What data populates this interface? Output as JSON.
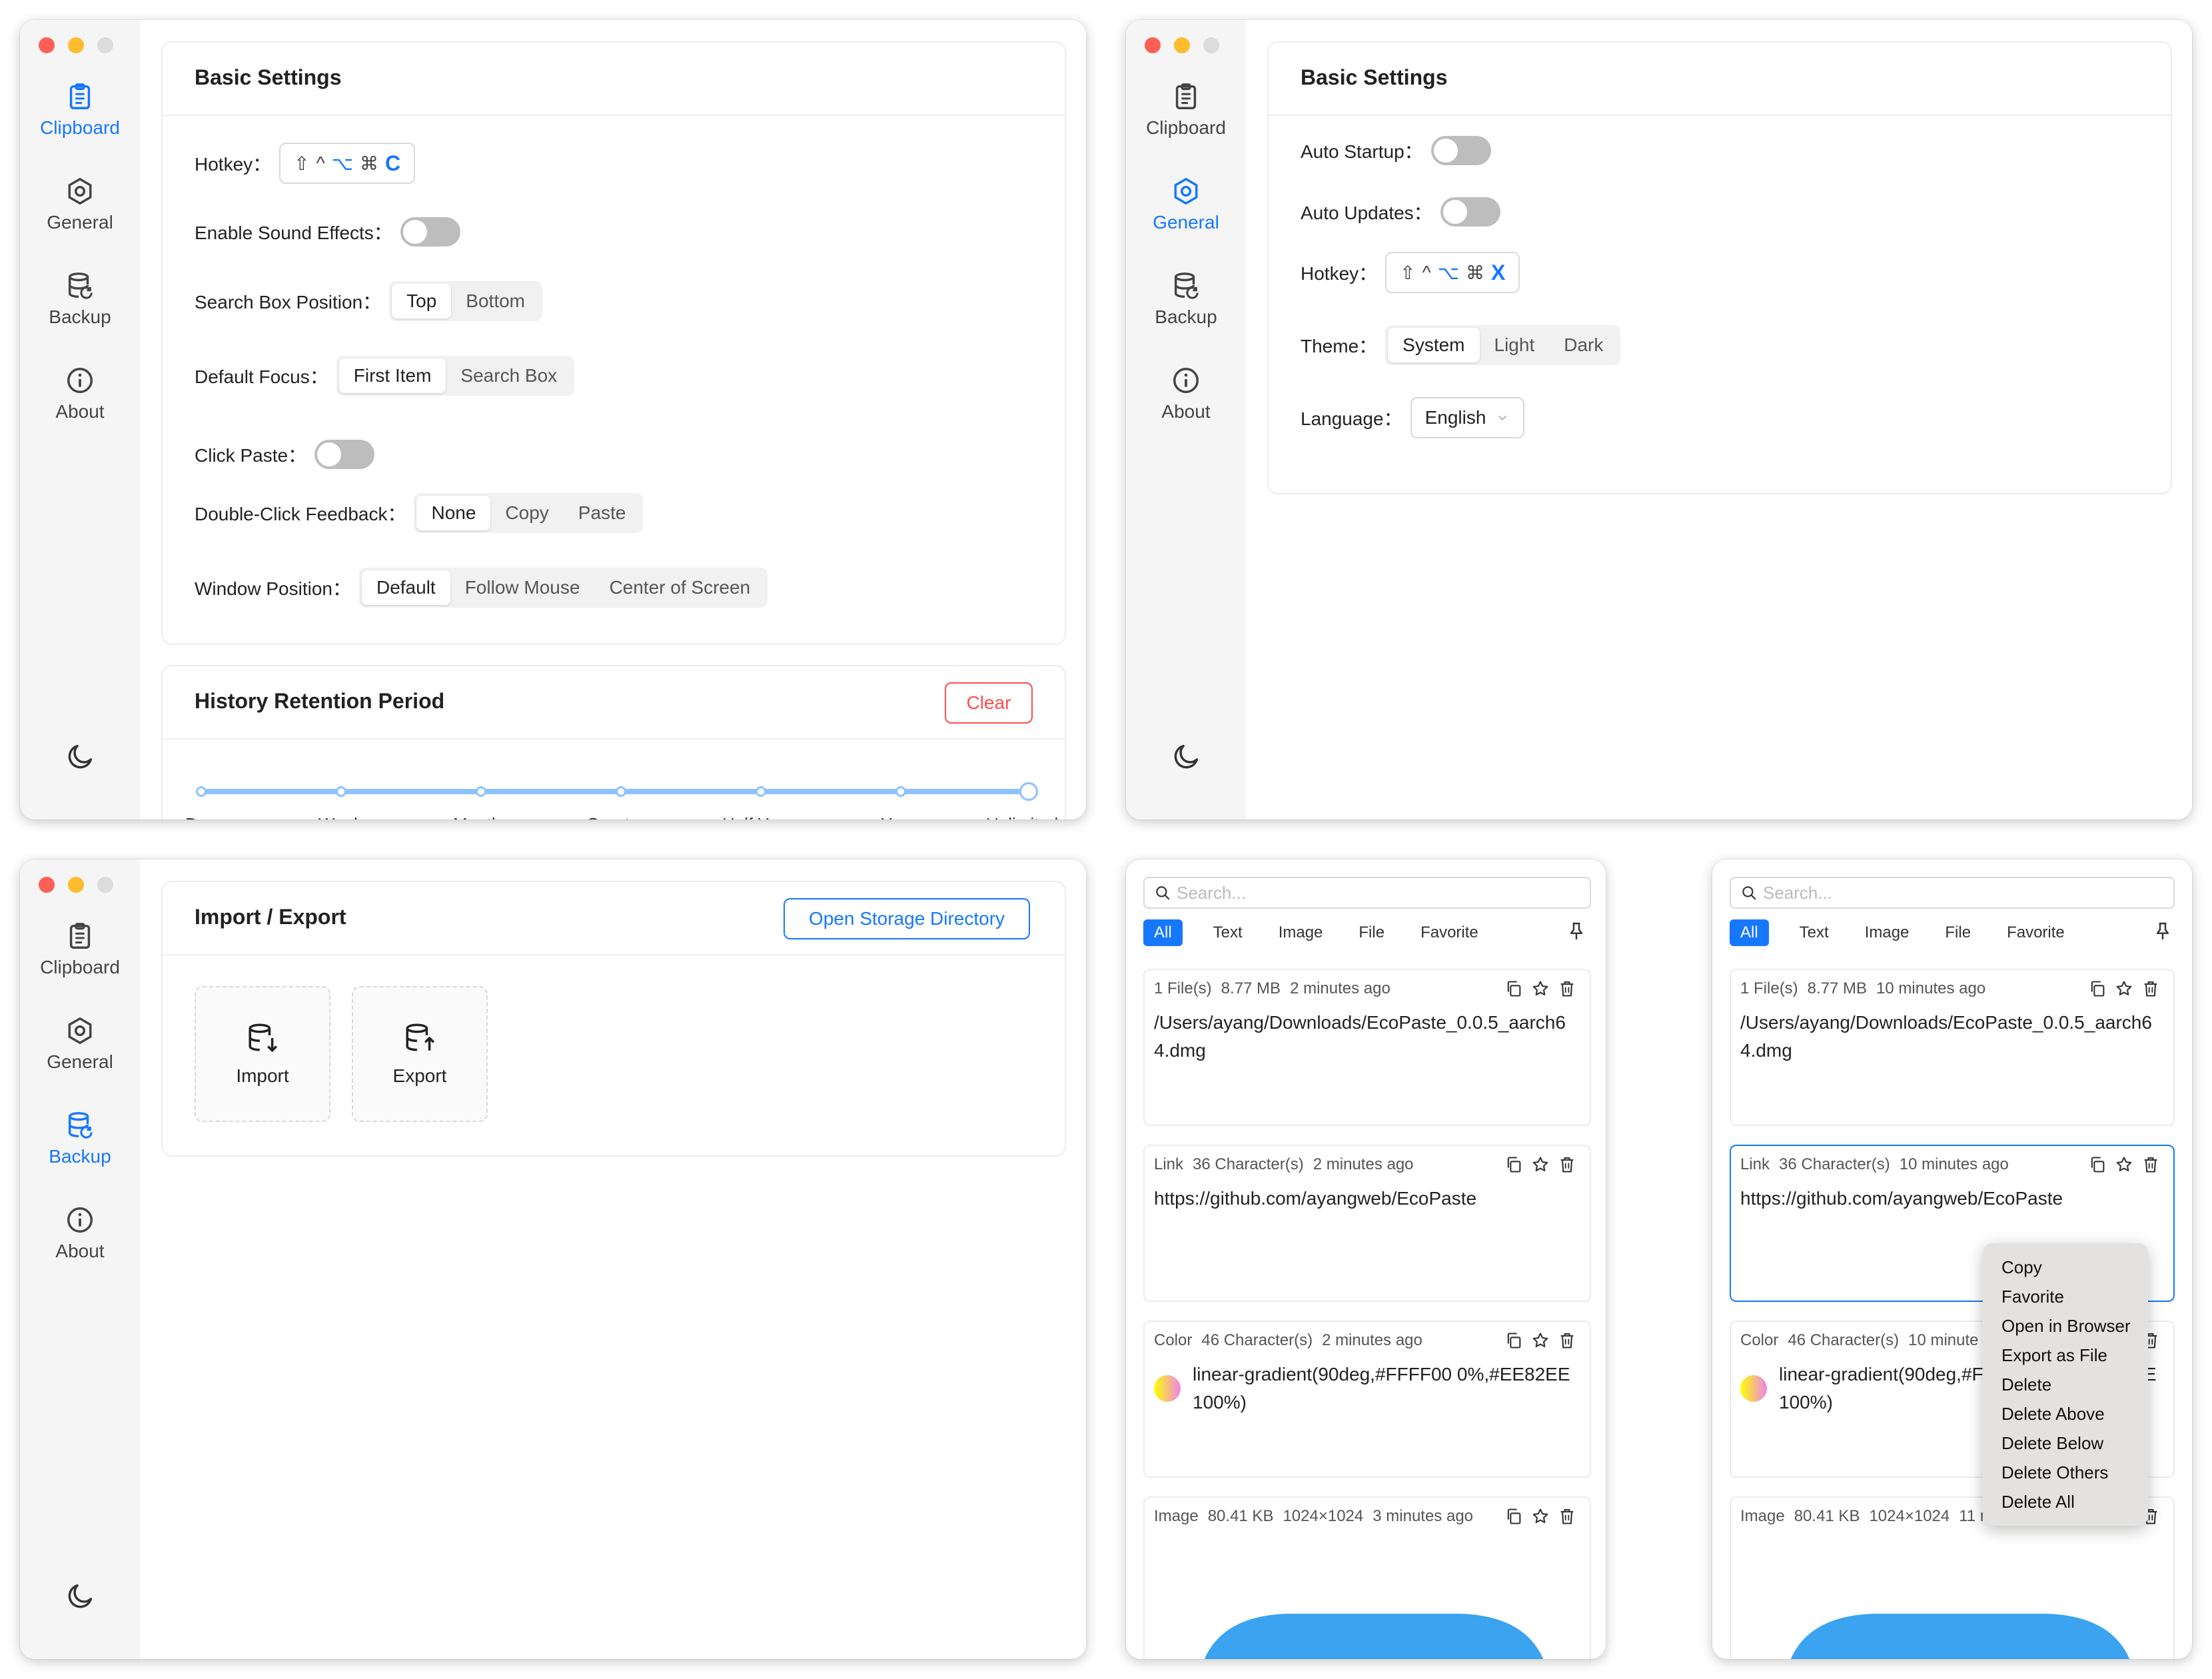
{
  "sidebar": {
    "clipboard": "Clipboard",
    "general": "General",
    "backup": "Backup",
    "about": "About"
  },
  "clip_settings": {
    "basic_title": "Basic Settings",
    "hotkey_label": "Hotkey：",
    "hotkey_key": "C",
    "sound_label": "Enable Sound Effects：",
    "search_pos_label": "Search Box Position：",
    "search_pos_options": [
      "Top",
      "Bottom"
    ],
    "focus_label": "Default Focus：",
    "focus_options": [
      "First Item",
      "Search Box"
    ],
    "click_paste_label": "Click Paste：",
    "dbl_label": "Double-Click Feedback：",
    "dbl_options": [
      "None",
      "Copy",
      "Paste"
    ],
    "winpos_label": "Window Position：",
    "winpos_options": [
      "Default",
      "Follow Mouse",
      "Center of Screen"
    ],
    "history_title": "History Retention Period",
    "clear_label": "Clear",
    "retention_ticks": [
      "Day",
      "Week",
      "Month",
      "Quarter",
      "Half Year",
      "Year",
      "Unlimited"
    ],
    "retention_selected": "Unlimited"
  },
  "general_settings": {
    "basic_title": "Basic Settings",
    "auto_startup_label": "Auto Startup：",
    "auto_updates_label": "Auto Updates：",
    "hotkey_label": "Hotkey：",
    "hotkey_key": "X",
    "theme_label": "Theme：",
    "theme_options": [
      "System",
      "Light",
      "Dark"
    ],
    "language_label": "Language：",
    "language_value": "English"
  },
  "backup": {
    "title": "Import / Export",
    "open_dir": "Open Storage Directory",
    "import": "Import",
    "export": "Export"
  },
  "clipboard_window": {
    "search_placeholder": "Search...",
    "tabs": [
      "All",
      "Text",
      "Image",
      "File",
      "Favorite"
    ]
  },
  "left_list": [
    {
      "meta": [
        "1 File(s)",
        "8.77 MB",
        "2 minutes ago"
      ],
      "content": "/Users/ayang/Downloads/EcoPaste_0.0.5_aarch64.dmg"
    },
    {
      "meta": [
        "Link",
        "36 Character(s)",
        "2 minutes ago"
      ],
      "content": "https://github.com/ayangweb/EcoPaste"
    },
    {
      "meta": [
        "Color",
        "46 Character(s)",
        "2 minutes ago"
      ],
      "content": "linear-gradient(90deg,#FFFF00 0%,#EE82EE 100%)"
    },
    {
      "meta": [
        "Image",
        "80.41 KB",
        "1024×1024",
        "3 minutes ago"
      ]
    }
  ],
  "right_list": [
    {
      "meta": [
        "1 File(s)",
        "8.77 MB",
        "10 minutes ago"
      ],
      "content": "/Users/ayang/Downloads/EcoPaste_0.0.5_aarch64.dmg"
    },
    {
      "meta": [
        "Link",
        "36 Character(s)",
        "10 minutes ago"
      ],
      "content": "https://github.com/ayangweb/EcoPaste"
    },
    {
      "meta": [
        "Color",
        "46 Character(s)",
        "10 minute"
      ],
      "content": "linear-gradient(90deg,#FFFF00 0%,#EE82EE 100%)"
    },
    {
      "meta": [
        "Image",
        "80.41 KB",
        "1024×1024",
        "11 m"
      ]
    }
  ],
  "context_menu": [
    "Copy",
    "Favorite",
    "Open in Browser",
    "Export as File",
    "Delete",
    "Delete Above",
    "Delete Below",
    "Delete Others",
    "Delete All"
  ],
  "colors": {
    "accent": "#1677ff",
    "danger": "#ff4d4f",
    "image_blue": "#3ba3ef",
    "slider": "#8ec2ff"
  }
}
